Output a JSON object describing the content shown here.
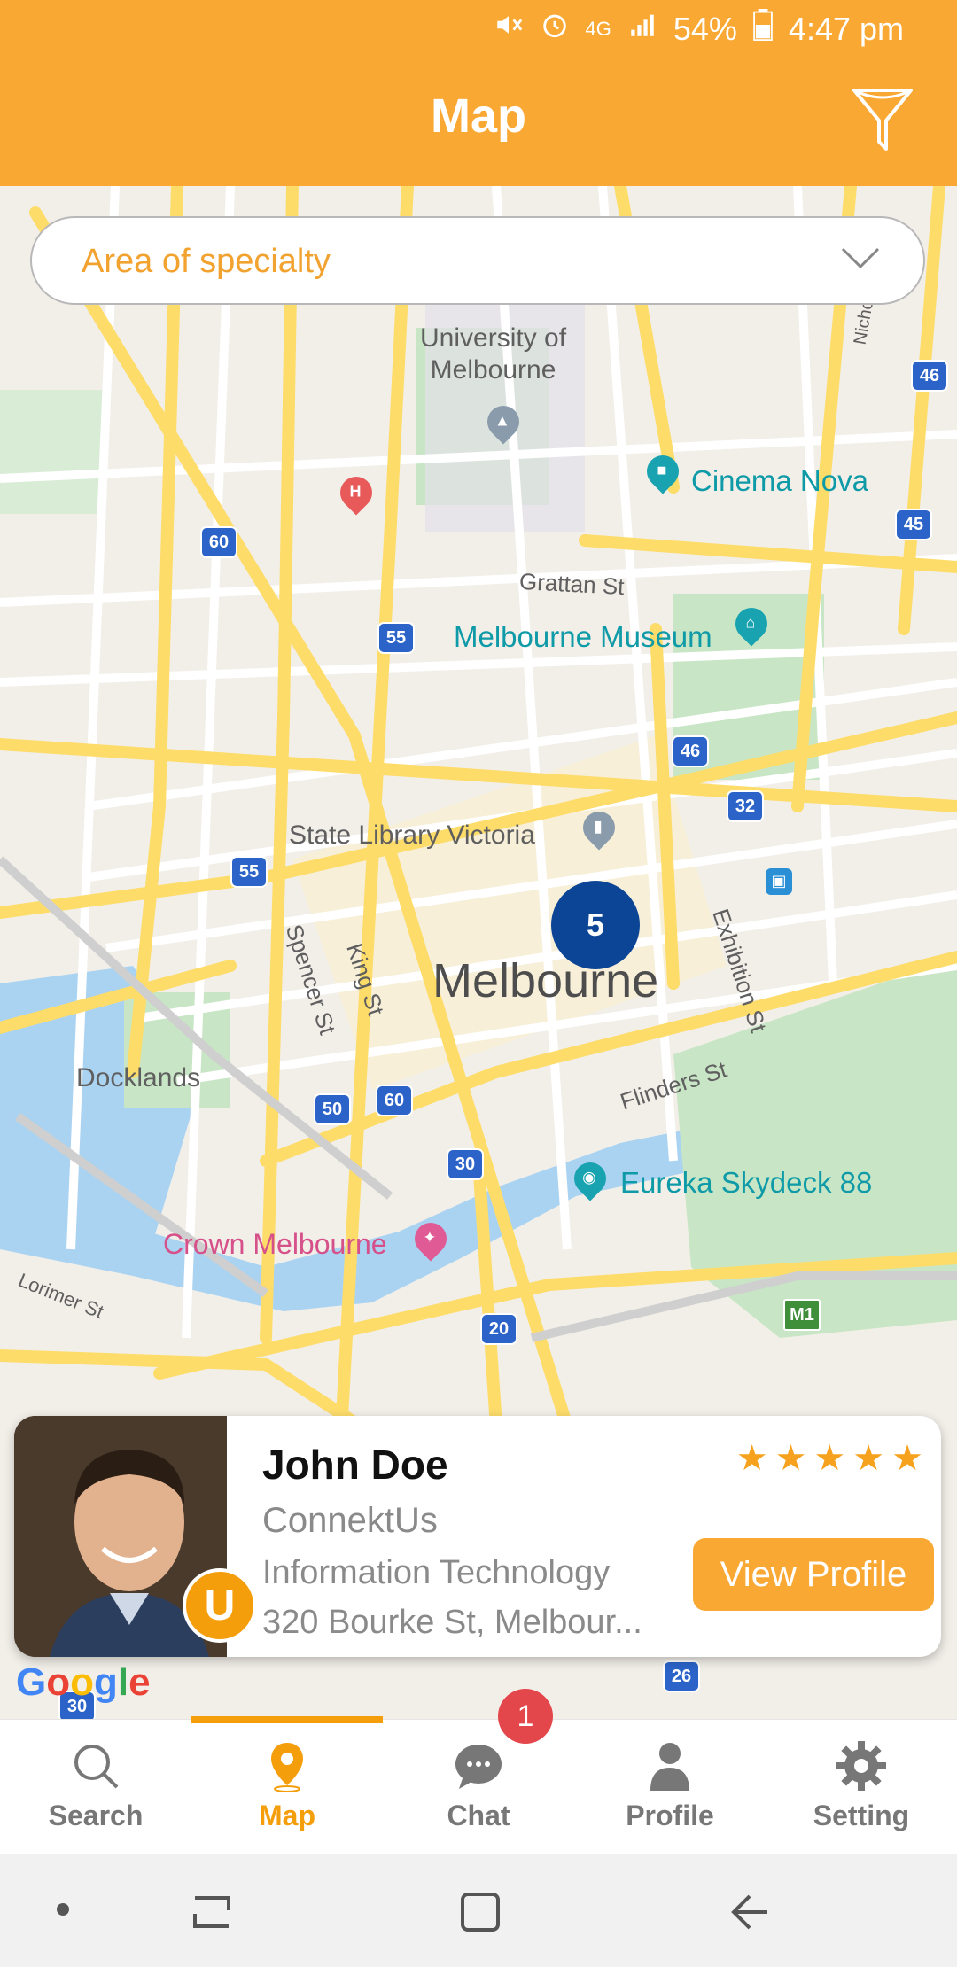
{
  "status_bar": {
    "battery": "54%",
    "time": "4:47 pm",
    "network": "4G"
  },
  "header": {
    "title": "Map"
  },
  "search": {
    "placeholder": "Area of specialty"
  },
  "map": {
    "places": {
      "university": "University of\nMelbourne",
      "cinema": "Cinema Nova",
      "museum": "Melbourne Museum",
      "library": "State Library Victoria",
      "city": "Melbourne",
      "docklands": "Docklands",
      "crown": "Crown Melbourne",
      "eureka": "Eureka Skydeck 88"
    },
    "streets": {
      "grattan": "Grattan St",
      "spencer": "Spencer St",
      "king": "King St",
      "exhibition": "Exhibition St",
      "flinders": "Flinders St",
      "lorimer": "Lorimer St",
      "nichol": "Nichol"
    },
    "routes": [
      "46",
      "45",
      "60",
      "55",
      "46",
      "32",
      "55",
      "50",
      "60",
      "30",
      "20",
      "26",
      "30"
    ],
    "freeway": "M1",
    "cluster_count": "5",
    "attribution": "Google"
  },
  "card": {
    "name": "John Doe",
    "company": "ConnektUs",
    "industry": "Information Technology",
    "address": "320 Bourke St, Melbour...",
    "rating": 5,
    "button": "View Profile"
  },
  "nav": {
    "items": [
      "Search",
      "Map",
      "Chat",
      "Profile",
      "Setting"
    ],
    "active": "Map",
    "chat_badge": "1"
  },
  "colors": {
    "brand": "#FAA834",
    "cluster": "#0D4596",
    "badge": "#E3474B"
  }
}
